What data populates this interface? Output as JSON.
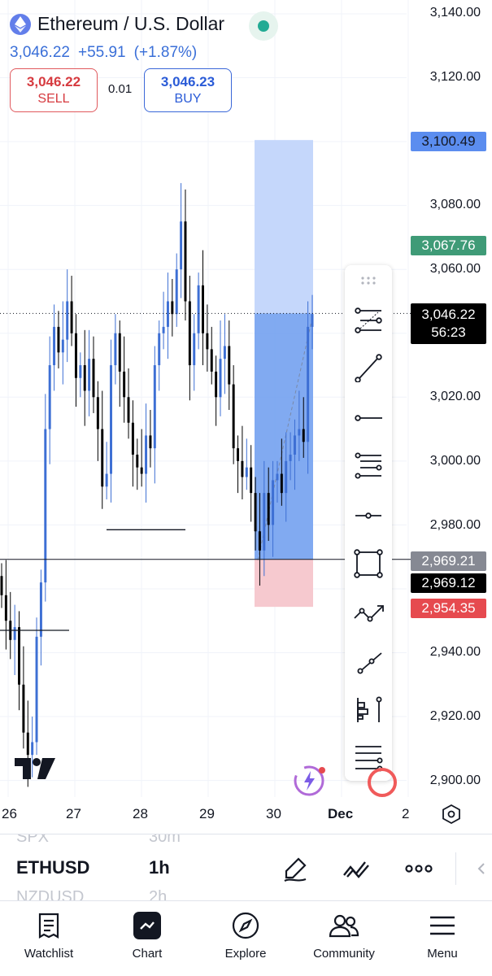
{
  "header": {
    "title": "Ethereum / U.S. Dollar",
    "last_price": "3,046.22",
    "change": "+55.91",
    "change_pct": "(+1.87%)",
    "sell_price": "3,046.22",
    "sell_label": "SELL",
    "buy_price": "3,046.23",
    "buy_label": "BUY",
    "spread": "0.01",
    "market_status_color": "#22ab94"
  },
  "price_axis": {
    "labels": [
      "3,140.00",
      "3,120.00",
      "3,080.00",
      "3,060.00",
      "3,020.00",
      "3,000.00",
      "2,980.00",
      "2,940.00",
      "2,920.00",
      "2,900.00"
    ],
    "tags": {
      "target": "3,100.49",
      "entry_green": "3,067.76",
      "current_price": "3,046.22",
      "countdown": "56:23",
      "line_gray": "2,969.21",
      "line_black": "2,969.12",
      "stop": "2,954.35"
    },
    "tag_colors": {
      "target": "#5b8def",
      "entry_green": "#3f9b77",
      "line_gray": "#868993",
      "line_black": "#000000",
      "stop": "#e64a4f"
    }
  },
  "time_axis": {
    "labels": [
      "26",
      "27",
      "28",
      "29",
      "30",
      "Dec",
      "2"
    ]
  },
  "drawing_tools": [
    "fib-retracement-icon",
    "trend-line-icon",
    "horizontal-ray-icon",
    "fib-extension-icon",
    "horizontal-line-icon",
    "rectangle-icon",
    "path-icon",
    "ray-icon",
    "long-position-icon",
    "parallel-lines-icon"
  ],
  "symbol_bar": {
    "prev_symbol": "SPX",
    "prev_interval": "30m",
    "symbol": "ETHUSD",
    "interval": "1h",
    "next_symbol": "NZDUSD",
    "next_interval": "2h"
  },
  "nav": {
    "items": [
      {
        "label": "Watchlist",
        "icon": "watchlist-icon"
      },
      {
        "label": "Chart",
        "icon": "chart-icon"
      },
      {
        "label": "Explore",
        "icon": "compass-icon"
      },
      {
        "label": "Community",
        "icon": "community-icon"
      },
      {
        "label": "Menu",
        "icon": "menu-icon"
      }
    ]
  },
  "colors": {
    "up": "#3d6fd4",
    "down": "#000000",
    "profit_zone": "#6b9bef",
    "stop_zone": "#f6c9cf"
  },
  "chart_data": {
    "type": "candlestick",
    "interval": "1h",
    "y_axis_ticks": [
      3140,
      3120,
      3100,
      3080,
      3060,
      3040,
      3020,
      3000,
      2980,
      2960,
      2940,
      2920,
      2900
    ],
    "ylim": [
      2895,
      3145
    ],
    "x_ticks": [
      "26",
      "27",
      "28",
      "29",
      "30",
      "Dec",
      "2"
    ],
    "last_price": 3046.22,
    "position": {
      "type": "long",
      "entry": 2969.21,
      "target": 3100.49,
      "stop": 2954.35
    },
    "horizontal_lines": [
      2969.12,
      2984.0
    ],
    "closes": [
      2958,
      2950,
      2944,
      2948,
      2930,
      2915,
      2908,
      2912,
      2945,
      2962,
      3010,
      3030,
      3042,
      3034,
      3038,
      3050,
      3040,
      3026,
      3030,
      3022,
      3032,
      3020,
      3010,
      2992,
      2996,
      3030,
      3040,
      3028,
      3020,
      3012,
      3002,
      2998,
      2996,
      3008,
      3004,
      3030,
      3040,
      3042,
      3050,
      3046,
      3060,
      3075,
      3050,
      3030,
      3040,
      3055,
      3040,
      3035,
      3028,
      3020,
      3032,
      3036,
      3024,
      3004,
      3000,
      2995,
      2998,
      2990,
      2978,
      2972,
      2990,
      2980,
      2994,
      2996,
      2990,
      3000,
      3002,
      3008,
      3010,
      3006,
      3042,
      3046
    ]
  }
}
